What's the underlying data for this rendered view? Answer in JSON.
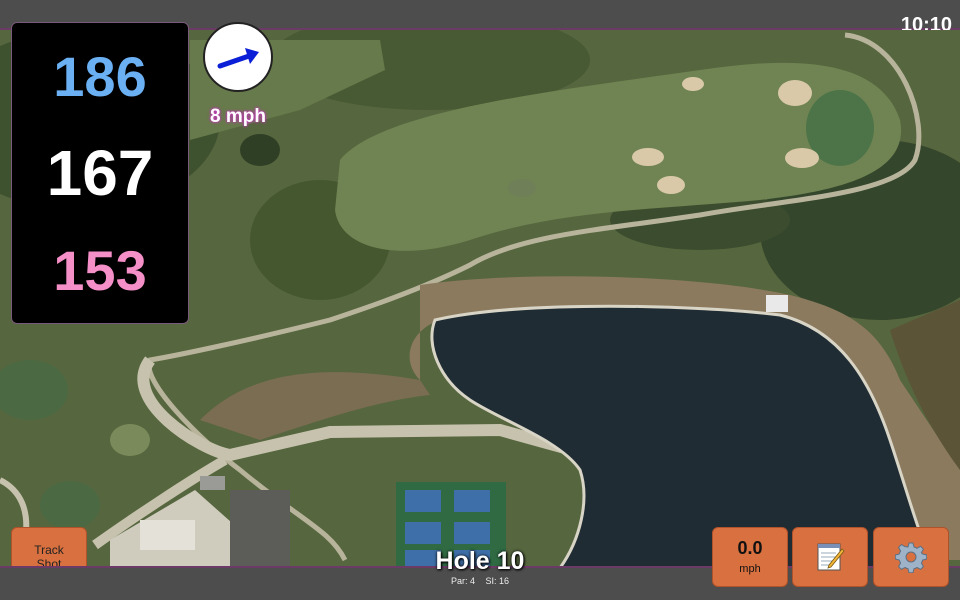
{
  "status_bar": {
    "clock": "10:10"
  },
  "distances": {
    "back": "186",
    "middle": "167",
    "front": "153"
  },
  "wind": {
    "speed_label": "8 mph",
    "arrow_color": "#0b1fd6"
  },
  "hole": {
    "title": "Hole 10",
    "par_label": "Par: 4",
    "si_label": "SI: 16"
  },
  "buttons": {
    "track_shot": {
      "line1": "Track",
      "line2": "Shot"
    },
    "speed": {
      "value": "0.0",
      "unit": "mph"
    },
    "notes": {
      "icon": "notepad-pencil-icon"
    },
    "settings": {
      "icon": "gear-icon"
    }
  },
  "colors": {
    "back_distance": "#6ab0f3",
    "middle_distance": "#ffffff",
    "front_distance": "#f58fc8",
    "button_bg": "#d8703f",
    "button_border": "#b0522a",
    "panel_border": "#6b3a66"
  }
}
